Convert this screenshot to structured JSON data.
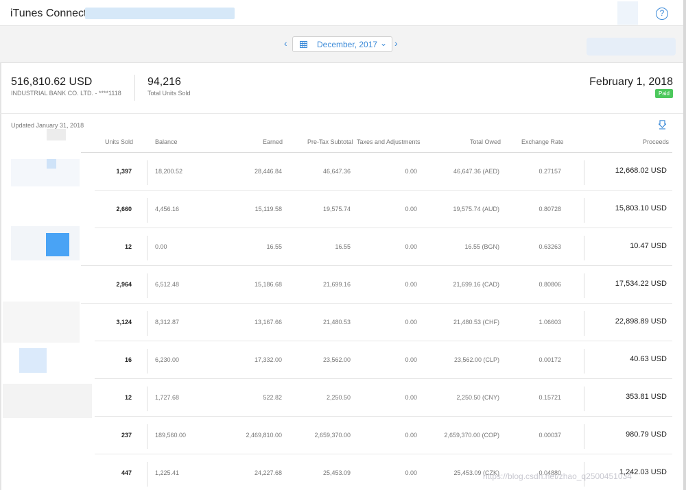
{
  "header": {
    "app_title": "iTunes Connect",
    "help_icon": "question-circle-icon",
    "help_glyph": "?"
  },
  "datebar": {
    "prev_glyph": "‹",
    "next_glyph": "›",
    "selected_month": "December, 2017",
    "caret_glyph": "⌄",
    "calendar_icon": "calendar-icon"
  },
  "summary": {
    "amount": "516,810.62 USD",
    "bank": "INDUSTRIAL BANK CO. LTD. - ****1118",
    "units_total": "94,216",
    "units_label": "Total Units Sold",
    "payment_date": "February 1, 2018",
    "status": "Paid"
  },
  "updated": "Updated January 31, 2018",
  "table": {
    "columns": [
      "Units Sold",
      "Balance",
      "Earned",
      "Pre-Tax Subtotal",
      "Taxes and Adjustments",
      "Total Owed",
      "Exchange Rate",
      "Proceeds"
    ],
    "rows": [
      {
        "units": "1,397",
        "balance": "18,200.52",
        "earned": "28,446.84",
        "pretax": "46,647.36",
        "taxes": "0.00",
        "owed": "46,647.36 (AED)",
        "rate": "0.27157",
        "proceeds": "12,668.02 USD"
      },
      {
        "units": "2,660",
        "balance": "4,456.16",
        "earned": "15,119.58",
        "pretax": "19,575.74",
        "taxes": "0.00",
        "owed": "19,575.74 (AUD)",
        "rate": "0.80728",
        "proceeds": "15,803.10 USD"
      },
      {
        "units": "12",
        "balance": "0.00",
        "earned": "16.55",
        "pretax": "16.55",
        "taxes": "0.00",
        "owed": "16.55 (BGN)",
        "rate": "0.63263",
        "proceeds": "10.47 USD"
      },
      {
        "units": "2,964",
        "balance": "6,512.48",
        "earned": "15,186.68",
        "pretax": "21,699.16",
        "taxes": "0.00",
        "owed": "21,699.16 (CAD)",
        "rate": "0.80806",
        "proceeds": "17,534.22 USD"
      },
      {
        "units": "3,124",
        "balance": "8,312.87",
        "earned": "13,167.66",
        "pretax": "21,480.53",
        "taxes": "0.00",
        "owed": "21,480.53 (CHF)",
        "rate": "1.06603",
        "proceeds": "22,898.89 USD"
      },
      {
        "units": "16",
        "balance": "6,230.00",
        "earned": "17,332.00",
        "pretax": "23,562.00",
        "taxes": "0.00",
        "owed": "23,562.00 (CLP)",
        "rate": "0.00172",
        "proceeds": "40.63 USD"
      },
      {
        "units": "12",
        "balance": "1,727.68",
        "earned": "522.82",
        "pretax": "2,250.50",
        "taxes": "0.00",
        "owed": "2,250.50 (CNY)",
        "rate": "0.15721",
        "proceeds": "353.81 USD"
      },
      {
        "units": "237",
        "balance": "189,560.00",
        "earned": "2,469,810.00",
        "pretax": "2,659,370.00",
        "taxes": "0.00",
        "owed": "2,659,370.00 (COP)",
        "rate": "0.00037",
        "proceeds": "980.79 USD"
      },
      {
        "units": "447",
        "balance": "1,225.41",
        "earned": "24,227.68",
        "pretax": "25,453.09",
        "taxes": "0.00",
        "owed": "25,453.09 (CZK)",
        "rate": "0.04880",
        "proceeds": "1,242.03 USD"
      }
    ]
  },
  "watermark": "https://blog.csdn.net/zhao_q2500451034",
  "colors": {
    "accent": "#3b8ad8",
    "paid_badge": "#4cc85c"
  }
}
